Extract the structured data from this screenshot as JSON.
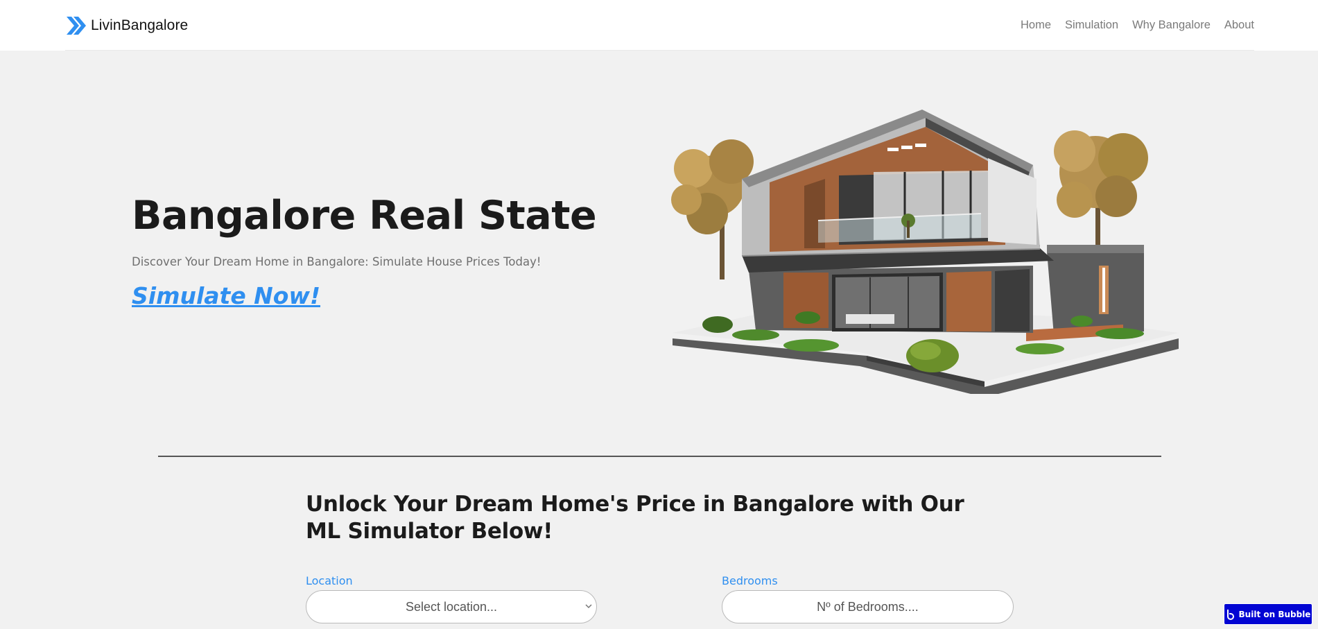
{
  "header": {
    "brand": {
      "name": "LivinBangalore",
      "icon": "double-chevron-right-icon",
      "accent_color": "#2f8ff0"
    },
    "nav": [
      {
        "label": "Home"
      },
      {
        "label": "Simulation"
      },
      {
        "label": "Why Bangalore"
      },
      {
        "label": "About"
      }
    ]
  },
  "hero": {
    "title": "Bangalore Real State",
    "subtitle": "Discover Your Dream Home in Bangalore: Simulate House Prices Today!",
    "cta": "Simulate Now!",
    "image": "modern-house-illustration"
  },
  "simulator": {
    "heading": "Unlock Your Dream Home's Price in Bangalore with Our ML Simulator Below!",
    "fields": [
      {
        "label": "Location",
        "placeholder": "Select location...",
        "type": "select"
      },
      {
        "label": "Bedrooms",
        "placeholder": "Nº of Bedrooms....",
        "type": "input"
      }
    ]
  },
  "badge": {
    "label": "Built on Bubble",
    "icon": "bubble-logo-icon",
    "color": "#0205d3"
  }
}
